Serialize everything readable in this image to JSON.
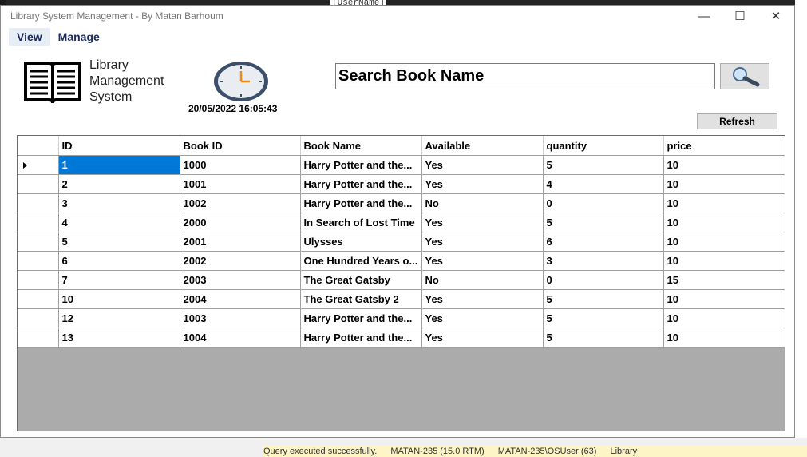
{
  "background": {
    "top_code": "[UserName]",
    "status_items": [
      "Query executed successfully.",
      "MATAN-235 (15.0 RTM)",
      "MATAN-235\\OSUser (63)",
      "Library"
    ]
  },
  "window": {
    "title": "Library System Management - By Matan Barhoum",
    "controls": {
      "minimize": "—",
      "maximize": "☐",
      "close": "✕"
    }
  },
  "menu": {
    "items": [
      "View",
      "Manage"
    ]
  },
  "header": {
    "app_title_lines": [
      "Library",
      "Management",
      "System"
    ],
    "datetime": "20/05/2022 16:05:43"
  },
  "search": {
    "value": "Search Book Name",
    "icon": "magnifier-icon"
  },
  "refresh_label": "Refresh",
  "grid": {
    "columns": [
      "ID",
      "Book ID",
      "Book Name",
      "Available",
      "quantity",
      "price"
    ],
    "rows": [
      [
        "1",
        "1000",
        "Harry Potter and the...",
        "Yes",
        "5",
        "10"
      ],
      [
        "2",
        "1001",
        "Harry Potter and the...",
        "Yes",
        "4",
        "10"
      ],
      [
        "3",
        "1002",
        "Harry Potter and the...",
        "No",
        "0",
        "10"
      ],
      [
        "4",
        "2000",
        "In Search of Lost Time",
        "Yes",
        "5",
        "10"
      ],
      [
        "5",
        "2001",
        "Ulysses",
        "Yes",
        "6",
        "10"
      ],
      [
        "6",
        "2002",
        "One Hundred Years o...",
        "Yes",
        "3",
        "10"
      ],
      [
        "7",
        "2003",
        "The Great Gatsby",
        "No",
        "0",
        "15"
      ],
      [
        "10",
        "2004",
        "The Great Gatsby 2",
        "Yes",
        "5",
        "10"
      ],
      [
        "12",
        "1003",
        "Harry Potter and the...",
        "Yes",
        "5",
        "10"
      ],
      [
        "13",
        "1004",
        "Harry Potter and the...",
        "Yes",
        "5",
        "10"
      ]
    ],
    "selected_row": 0,
    "empty_area_color": "#ababab",
    "selection_color": "#0078d7"
  }
}
